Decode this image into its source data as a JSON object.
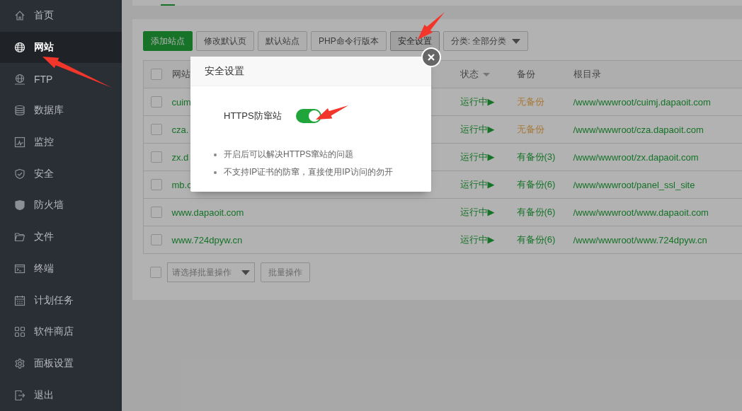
{
  "sidebar": {
    "items": [
      {
        "label": "首页",
        "selected": false
      },
      {
        "label": "网站",
        "selected": true
      },
      {
        "label": "FTP",
        "selected": false
      },
      {
        "label": "数据库",
        "selected": false
      },
      {
        "label": "监控",
        "selected": false
      },
      {
        "label": "安全",
        "selected": false
      },
      {
        "label": "防火墙",
        "selected": false
      },
      {
        "label": "文件",
        "selected": false
      },
      {
        "label": "终端",
        "selected": false
      },
      {
        "label": "计划任务",
        "selected": false
      },
      {
        "label": "软件商店",
        "selected": false
      },
      {
        "label": "面板设置",
        "selected": false
      },
      {
        "label": "退出",
        "selected": false
      }
    ]
  },
  "toolbar": {
    "buttons": [
      {
        "label": "添加站点",
        "kind": "primary"
      },
      {
        "label": "修改默认页",
        "kind": "default"
      },
      {
        "label": "默认站点",
        "kind": "default"
      },
      {
        "label": "PHP命令行版本",
        "kind": "default"
      },
      {
        "label": "安全设置",
        "kind": "pressed"
      },
      {
        "label": "分类: 全部分类",
        "kind": "dropdown"
      }
    ]
  },
  "table": {
    "select_all_checked": false,
    "columns": [
      {
        "label": "网站",
        "sortable": false
      },
      {
        "label": "状态",
        "sortable": true
      },
      {
        "label": "备份",
        "sortable": false
      },
      {
        "label": "根目录",
        "sortable": false
      }
    ],
    "rows": [
      {
        "checked": false,
        "name": "cuim",
        "status": "运行中▶",
        "backup": {
          "label": "无备份",
          "color": "#a87937"
        },
        "root": "/www/wwwroot/cuimj.dapaoit.com"
      },
      {
        "checked": false,
        "name": "cza.",
        "status": "运行中▶",
        "backup": {
          "label": "无备份",
          "color": "#a87937"
        },
        "root": "/www/wwwroot/cza.dapaoit.com"
      },
      {
        "checked": false,
        "name": "zx.d",
        "status": "运行中▶",
        "backup": {
          "label": "有备份(3)",
          "color": "#167429"
        },
        "root": "/www/wwwroot/zx.dapaoit.com"
      },
      {
        "checked": false,
        "name": "mb.c",
        "status": "运行中▶",
        "backup": {
          "label": "有备份(6)",
          "color": "#167429"
        },
        "root": "/www/wwwroot/panel_ssl_site"
      },
      {
        "checked": false,
        "name": "www.dapaoit.com",
        "status": "运行中▶",
        "backup": {
          "label": "有备份(6)",
          "color": "#167429"
        },
        "root": "/www/wwwroot/www.dapaoit.com"
      },
      {
        "checked": false,
        "name": "www.724dpyw.cn",
        "status": "运行中▶",
        "backup": {
          "label": "有备份(6)",
          "color": "#167429"
        },
        "root": "/www/wwwroot/www.724dpyw.cn"
      }
    ]
  },
  "batch": {
    "checked": false,
    "placeholder": "请选择批量操作",
    "button": "批量操作"
  },
  "modal": {
    "title": "安全设置",
    "settings": [
      {
        "label": "HTTPS防窜站",
        "on": true
      }
    ],
    "notes": [
      "开启后可以解决HTTPS窜站的问题",
      "不支持IP证书的防窜，直接使用IP访问的勿开"
    ]
  }
}
